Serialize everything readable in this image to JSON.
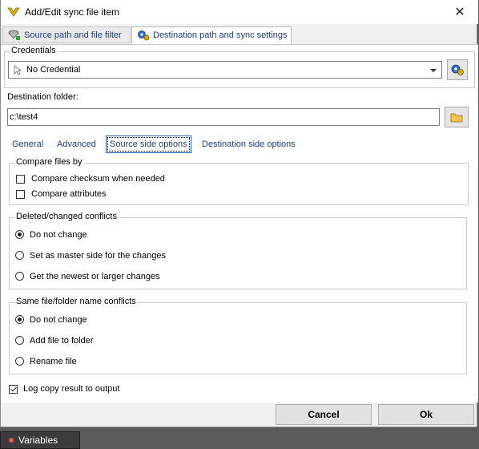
{
  "window": {
    "title": "Add/Edit sync file item",
    "close_glyph": "✕"
  },
  "tabs": [
    {
      "label": "Source path and file filter",
      "icon": "filter-icon"
    },
    {
      "label": "Destination path and sync settings",
      "icon": "gear-icon"
    }
  ],
  "credentials": {
    "legend": "Credentials",
    "value": "No Credential",
    "icon": "cursor-icon",
    "button_icon": "gear-icon"
  },
  "destination": {
    "label": "Destination folder:",
    "value": "c:\\test4",
    "button_icon": "folder-icon"
  },
  "subtabs": [
    "General",
    "Advanced",
    "Source side options",
    "Destination side options"
  ],
  "compare": {
    "legend": "Compare files by",
    "options": [
      {
        "label": "Compare checksum when needed",
        "checked": false
      },
      {
        "label": "Compare attributes",
        "checked": false
      }
    ]
  },
  "deleted": {
    "legend": "Deleted/changed conflicts",
    "options": [
      {
        "label": "Do not change",
        "checked": true
      },
      {
        "label": "Set as master side for the changes",
        "checked": false
      },
      {
        "label": "Get the newest or larger changes",
        "checked": false
      }
    ]
  },
  "samename": {
    "legend": "Same file/folder name conflicts",
    "options": [
      {
        "label": "Do not change",
        "checked": true
      },
      {
        "label": "Add file to folder",
        "checked": false
      },
      {
        "label": "Rename file",
        "checked": false
      }
    ]
  },
  "log": {
    "label": "Log copy result to output",
    "checked": true
  },
  "footer": {
    "cancel": "Cancel",
    "ok": "Ok"
  },
  "taskbar": {
    "label": "Variables"
  }
}
